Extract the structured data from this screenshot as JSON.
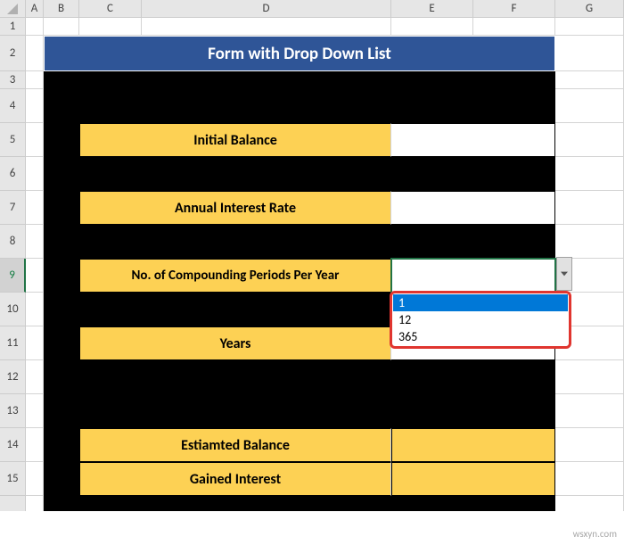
{
  "columns": [
    "A",
    "B",
    "C",
    "D",
    "E",
    "F",
    "G"
  ],
  "rows": [
    "1",
    "2",
    "3",
    "4",
    "5",
    "6",
    "7",
    "8",
    "9",
    "10",
    "11",
    "12",
    "13",
    "14",
    "15"
  ],
  "selectedRow": "9",
  "title": "Form with Drop Down List",
  "labels": {
    "initial_balance": "Initial Balance",
    "annual_rate": "Annual Interest Rate",
    "compounding": "No. of Compounding Periods Per Year",
    "years": "Years",
    "est_balance": "Estiamted Balance",
    "gained_interest": "Gained Interest"
  },
  "dropdown": {
    "options": [
      "1",
      "12",
      "365"
    ],
    "selected_index": 0
  },
  "watermark": "wsxyn.com"
}
